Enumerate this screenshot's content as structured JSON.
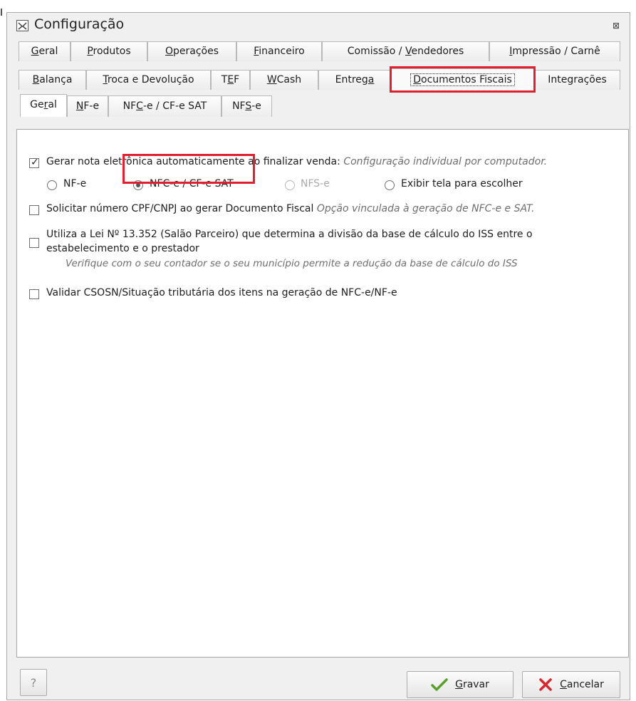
{
  "window": {
    "title": "Configuração",
    "close_glyph": "⊠",
    "icon": "app-config-icon"
  },
  "tabs_row1": [
    {
      "pre": "",
      "u": "G",
      "post": "eral"
    },
    {
      "pre": "",
      "u": "P",
      "post": "rodutos"
    },
    {
      "pre": "",
      "u": "O",
      "post": "perações"
    },
    {
      "pre": "",
      "u": "F",
      "post": "inanceiro"
    },
    {
      "pre": "Comissão / ",
      "u": "V",
      "post": "endedores"
    },
    {
      "pre": "",
      "u": "I",
      "post": "mpressão / Carnê"
    }
  ],
  "tabs_row2": [
    {
      "pre": "",
      "u": "B",
      "post": "alança"
    },
    {
      "pre": "",
      "u": "T",
      "post": "roca e Devolução"
    },
    {
      "pre": "T",
      "u": "E",
      "post": "F"
    },
    {
      "pre": "",
      "u": "W",
      "post": "Cash"
    },
    {
      "pre": "Entreg",
      "u": "a",
      "post": ""
    },
    {
      "pre": "",
      "u": "D",
      "post": "ocumentos Fiscais"
    },
    {
      "pre": "Integrações",
      "u": "",
      "post": ""
    }
  ],
  "subtabs": [
    {
      "pre": "Ge",
      "u": "r",
      "post": "al"
    },
    {
      "pre": "",
      "u": "N",
      "post": "F-e"
    },
    {
      "pre": "NF",
      "u": "C",
      "post": "-e / CF-e SAT"
    },
    {
      "pre": "NF",
      "u": "S",
      "post": "-e"
    }
  ],
  "options": {
    "auto_nf_label": "Gerar nota eletrônica automaticamente ao finalizar venda:",
    "auto_nf_hint": "Configuração individual por computador.",
    "auto_nf_checked": true,
    "radio_nfe": "NF-e",
    "radio_nfce": "NFC-e / CF-e SAT",
    "radio_nfse": "NFS-e",
    "radio_choose": "Exibir tela para escolher",
    "radio_selected": "nfce",
    "cpf_label": "Solicitar número CPF/CNPJ ao gerar Documento Fiscal",
    "cpf_hint": "Opção vinculada à geração de NFC-e e SAT.",
    "lei_line1": "Utiliza a Lei Nº 13.352 (Salão Parceiro) que determina a divisão da base de cálculo do ISS entre o",
    "lei_line2": "estabelecimento e o prestador",
    "lei_hint": "Verifique com o seu contador se o seu município permite a redução da base de cálculo do ISS",
    "validar_label": "Validar CSOSN/Situação tributária dos itens na geração de NFC-e/NF-e"
  },
  "buttons": {
    "help": "?",
    "gravar": {
      "pre": "",
      "u": "G",
      "post": "ravar"
    },
    "cancelar": {
      "pre": "",
      "u": "C",
      "post": "ancelar"
    }
  },
  "colors": {
    "highlight": "#e0202e",
    "check_green": "#5aa02c",
    "cancel_red": "#d8262e"
  }
}
